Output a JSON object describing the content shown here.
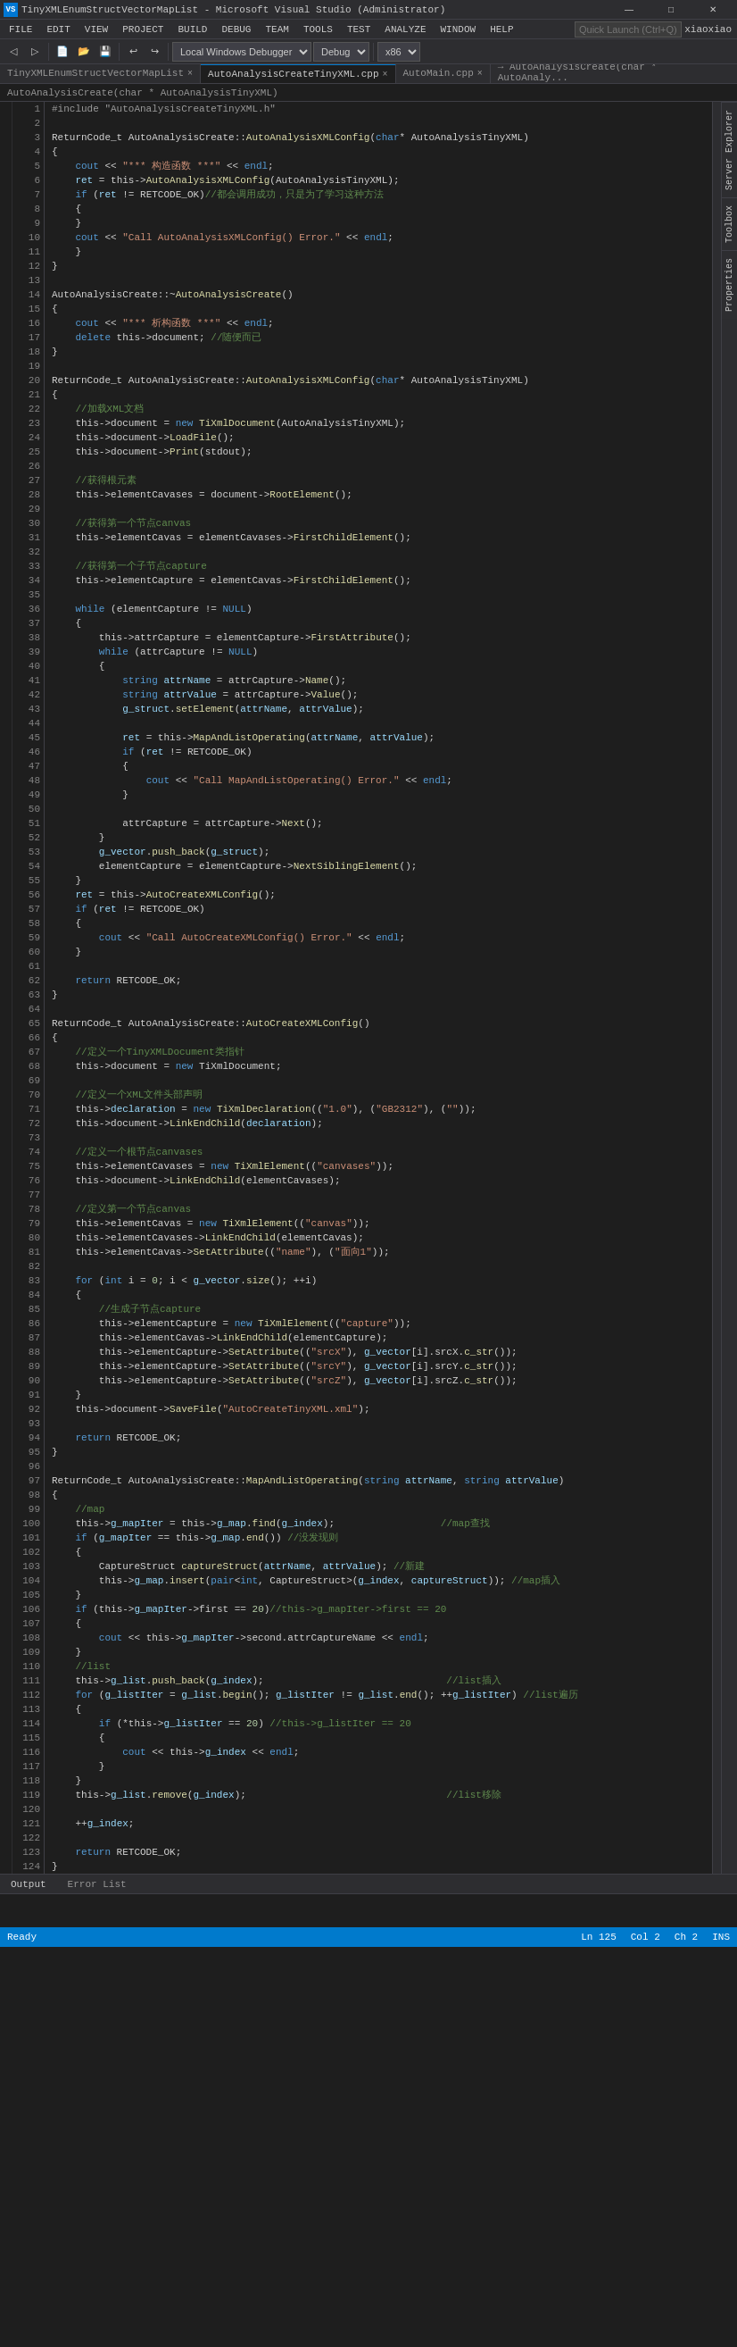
{
  "window": {
    "title": "TinyXMLEnumStructVectorMapList - Microsoft Visual Studio (Administrator)",
    "title_icon": "VS"
  },
  "titlebar": {
    "controls": [
      "—",
      "□",
      "✕"
    ]
  },
  "menubar": {
    "items": [
      "FILE",
      "EDIT",
      "VIEW",
      "PROJECT",
      "BUILD",
      "DEBUG",
      "TEAM",
      "TOOLS",
      "TEST",
      "ANALYZE",
      "WINDOW",
      "HELP"
    ]
  },
  "toolbar": {
    "config_dropdown": "Local Windows Debugger",
    "platform_dropdown": "Debug",
    "arch_dropdown": "x86",
    "username": "xiaoxiao"
  },
  "tabs": {
    "main_tabs": [
      {
        "label": "TinyXMLEnumStructVectorMapList",
        "active": false,
        "closable": true
      },
      {
        "label": "AutoAnalysisCreateTinyXML.cpp",
        "active": true,
        "closable": true
      },
      {
        "label": "AutoMain.cpp",
        "active": false,
        "closable": true
      }
    ],
    "nav_label": "→ AutoAnalysisCreate(char * AutoAnaly..."
  },
  "search": {
    "placeholder": "Quick Launch (Ctrl+Q)",
    "value": ""
  },
  "breadcrumb": "AutoAnalysisCreate(char * AutoAnalysisTinyXML)",
  "side_panels": {
    "server_explorer": "Server Explorer",
    "toolbox": "Toolbox",
    "properties": "Properties"
  },
  "code": {
    "filename": "AutoAnalysisCreateTinyXML.cpp",
    "lines": [
      {
        "num": 1,
        "text": "#include \"AutoAnalysisCreateTinyXML.h\"",
        "type": "preprocessor"
      },
      {
        "num": 2,
        "text": ""
      },
      {
        "num": 3,
        "text": "ReturnCode_t AutoAnalysisCreate::AutoAnalysisXMLConfig(char* AutoAnalysisTinyXML)",
        "type": "code"
      },
      {
        "num": 4,
        "text": "{"
      },
      {
        "num": 5,
        "text": "    cout << \"*** 构造函数 ***\" << endl;",
        "type": "code"
      },
      {
        "num": 6,
        "text": "    ret = this->AutoAnalysisXMLConfig(AutoAnalysisTinyXML);",
        "type": "code"
      },
      {
        "num": 7,
        "text": "    if (ret != RETCODE_OK)//都会调用成功，只是为了学习这种方法",
        "type": "code"
      },
      {
        "num": 8,
        "text": "    {"
      },
      {
        "num": 9,
        "text": "    }"
      },
      {
        "num": 10,
        "text": "    cout << \"Call AutoAnalysisXMLConfig() Error.\" << endl;",
        "type": "code"
      },
      {
        "num": 11,
        "text": "    }"
      },
      {
        "num": 12,
        "text": "}"
      },
      {
        "num": 13,
        "text": ""
      },
      {
        "num": 14,
        "text": "AutoAnalysisCreate::~AutoAnalysisCreate()",
        "type": "code"
      },
      {
        "num": 15,
        "text": "{"
      },
      {
        "num": 16,
        "text": "    cout << \"*** 析构函数 ***\" << endl;",
        "type": "code"
      },
      {
        "num": 17,
        "text": "    delete this->document; //随便而已",
        "type": "code"
      },
      {
        "num": 18,
        "text": "}"
      },
      {
        "num": 19,
        "text": ""
      },
      {
        "num": 20,
        "text": "ReturnCode_t AutoAnalysisCreate::AutoAnalysisXMLConfig(char* AutoAnalysisTinyXML)",
        "type": "code"
      },
      {
        "num": 21,
        "text": "{"
      },
      {
        "num": 22,
        "text": "    //加载XML文档"
      },
      {
        "num": 23,
        "text": "    this->document = new TiXmlDocument(AutoAnalysisTinyXML);"
      },
      {
        "num": 24,
        "text": "    this->document->LoadFile();"
      },
      {
        "num": 25,
        "text": "    this->document->Print(stdout);"
      },
      {
        "num": 26,
        "text": ""
      },
      {
        "num": 27,
        "text": "    //获得根元素"
      },
      {
        "num": 28,
        "text": "    this->elementCavases = document->RootElement();"
      },
      {
        "num": 29,
        "text": ""
      },
      {
        "num": 30,
        "text": "    //获得第一个节点canvas"
      },
      {
        "num": 31,
        "text": "    this->elementCavas = elementCavases->FirstChildElement();"
      },
      {
        "num": 32,
        "text": ""
      },
      {
        "num": 33,
        "text": "    //获得第一个子节点capture"
      },
      {
        "num": 34,
        "text": "    this->elementCapture = elementCavas->FirstChildElement();"
      },
      {
        "num": 35,
        "text": ""
      },
      {
        "num": 36,
        "text": "    while (elementCapture != NULL)"
      },
      {
        "num": 37,
        "text": "    {"
      },
      {
        "num": 38,
        "text": "        this->attrCapture = elementCapture->FirstAttribute();"
      },
      {
        "num": 39,
        "text": "        while (attrCapture != NULL)"
      },
      {
        "num": 40,
        "text": "        {"
      },
      {
        "num": 41,
        "text": "            string attrName = attrCapture->Name();"
      },
      {
        "num": 42,
        "text": "            string attrValue = attrCapture->Value();"
      },
      {
        "num": 43,
        "text": "            g_struct.setElement(attrName, attrValue);"
      },
      {
        "num": 44,
        "text": ""
      },
      {
        "num": 45,
        "text": "            ret = this->MapAndListOperating(attrName, attrValue);"
      },
      {
        "num": 46,
        "text": "            if (ret != RETCODE_OK)"
      },
      {
        "num": 47,
        "text": "            {"
      },
      {
        "num": 48,
        "text": "                cout << \"Call MapAndListOperating() Error.\" << endl;"
      },
      {
        "num": 49,
        "text": "            }"
      },
      {
        "num": 50,
        "text": ""
      },
      {
        "num": 51,
        "text": "            attrCapture = attrCapture->Next();"
      },
      {
        "num": 52,
        "text": "        }"
      },
      {
        "num": 53,
        "text": "        g_vector.push_back(g_struct);"
      },
      {
        "num": 54,
        "text": "        elementCapture = elementCapture->NextSiblingElement();"
      },
      {
        "num": 55,
        "text": "    }"
      },
      {
        "num": 56,
        "text": "    ret = this->AutoCreateXMLConfig();"
      },
      {
        "num": 57,
        "text": "    if (ret != RETCODE_OK)"
      },
      {
        "num": 58,
        "text": "    {"
      },
      {
        "num": 59,
        "text": "        cout << \"Call AutoCreateXMLConfig() Error.\" << endl;"
      },
      {
        "num": 60,
        "text": "    }"
      },
      {
        "num": 61,
        "text": ""
      },
      {
        "num": 62,
        "text": "    return RETCODE_OK;"
      },
      {
        "num": 63,
        "text": "}"
      },
      {
        "num": 64,
        "text": ""
      },
      {
        "num": 65,
        "text": "ReturnCode_t AutoAnalysisCreate::AutoCreateXMLConfig()",
        "type": "code"
      },
      {
        "num": 66,
        "text": "{"
      },
      {
        "num": 67,
        "text": "    //定义一个TinyXMLDocument类指针"
      },
      {
        "num": 68,
        "text": "    this->document = new TiXmlDocument;"
      },
      {
        "num": 69,
        "text": ""
      },
      {
        "num": 70,
        "text": "    //定义一个XML文件头部声明"
      },
      {
        "num": 71,
        "text": "    this->declaration = new TiXmlDeclaration((\"1.0\"), (\"GB2312\"), (\"\"));"
      },
      {
        "num": 72,
        "text": "    this->document->LinkEndChild(declaration);"
      },
      {
        "num": 73,
        "text": ""
      },
      {
        "num": 74,
        "text": "    //定义一个根节点canvases"
      },
      {
        "num": 75,
        "text": "    this->elementCavases = new TiXmlElement((\"canvases\"));"
      },
      {
        "num": 76,
        "text": "    this->document->LinkEndChild(elementCavases);"
      },
      {
        "num": 77,
        "text": ""
      },
      {
        "num": 78,
        "text": "    //定义第一个节点canvas"
      },
      {
        "num": 79,
        "text": "    this->elementCavas = new TiXmlElement((\"canvas\"));"
      },
      {
        "num": 80,
        "text": "    this->elementCavases->LinkEndChild(elementCavas);"
      },
      {
        "num": 81,
        "text": "    this->elementCavas->SetAttribute((\"name\"), (\"面向1\"));"
      },
      {
        "num": 82,
        "text": ""
      },
      {
        "num": 83,
        "text": "    for (int i = 0; i < g_vector.size(); ++i)"
      },
      {
        "num": 84,
        "text": "    {"
      },
      {
        "num": 85,
        "text": "        //生成子节点capture"
      },
      {
        "num": 86,
        "text": "        this->elementCapture = new TiXmlElement((\"capture\"));"
      },
      {
        "num": 87,
        "text": "        this->elementCavas->LinkEndChild(elementCapture);"
      },
      {
        "num": 88,
        "text": "        this->elementCapture->SetAttribute((\"srcX\"), g_vector[i].srcX.c_str());"
      },
      {
        "num": 89,
        "text": "        this->elementCapture->SetAttribute((\"srcY\"), g_vector[i].srcY.c_str());"
      },
      {
        "num": 90,
        "text": "        this->elementCapture->SetAttribute((\"srcZ\"), g_vector[i].srcZ.c_str());"
      },
      {
        "num": 91,
        "text": "    }"
      },
      {
        "num": 92,
        "text": "    this->document->SaveFile(\"AutoCreateTinyXML.xml\");"
      },
      {
        "num": 93,
        "text": ""
      },
      {
        "num": 94,
        "text": "    return RETCODE_OK;"
      },
      {
        "num": 95,
        "text": "}"
      },
      {
        "num": 96,
        "text": ""
      },
      {
        "num": 97,
        "text": "ReturnCode_t AutoAnalysisCreate::MapAndListOperating(string attrName, string attrValue)"
      },
      {
        "num": 98,
        "text": "{"
      },
      {
        "num": 99,
        "text": "    //map"
      },
      {
        "num": 100,
        "text": "    this->g_mapIter = this->g_map.find(g_index);                  //map查找"
      },
      {
        "num": 101,
        "text": "    if (g_mapIter == this->g_map.end()) //没发现则"
      },
      {
        "num": 102,
        "text": "    {"
      },
      {
        "num": 103,
        "text": "        CaptureStruct captureStruct(attrName, attrValue); //新建"
      },
      {
        "num": 104,
        "text": "        this->g_map.insert(pair<int, CaptureStruct>(g_index, captureStruct)); //map插入"
      },
      {
        "num": 105,
        "text": "    }"
      },
      {
        "num": 106,
        "text": "    if (this->g_mapIter->first == 20)//this->g_mapIter->first == 20"
      },
      {
        "num": 107,
        "text": "    {"
      },
      {
        "num": 108,
        "text": "        cout << this->g_mapIter->second.attrCaptureName << endl;"
      },
      {
        "num": 109,
        "text": "    }"
      },
      {
        "num": 110,
        "text": "    //list"
      },
      {
        "num": 111,
        "text": "    this->g_list.push_back(g_index);                               //list插入"
      },
      {
        "num": 112,
        "text": "    for (g_listIter = g_list.begin(); g_listIter != g_list.end(); ++g_listIter) //list遍历"
      },
      {
        "num": 113,
        "text": "    {"
      },
      {
        "num": 114,
        "text": "        if (*this->g_listIter == 20) //this->g_listIter == 20"
      },
      {
        "num": 115,
        "text": "        {"
      },
      {
        "num": 116,
        "text": "            cout << this->g_index << endl;"
      },
      {
        "num": 117,
        "text": "        }"
      },
      {
        "num": 118,
        "text": "    }"
      },
      {
        "num": 119,
        "text": "    this->g_list.remove(g_index);                                  //list移除"
      },
      {
        "num": 120,
        "text": ""
      },
      {
        "num": 121,
        "text": "    ++g_index;"
      },
      {
        "num": 122,
        "text": ""
      },
      {
        "num": 123,
        "text": "    return RETCODE_OK;"
      },
      {
        "num": 124,
        "text": "}"
      }
    ]
  },
  "status_bar": {
    "ready": "Ready",
    "ln": "Ln 125",
    "col": "Col 2",
    "ch": "Ch 2",
    "ins": "INS"
  },
  "bottom_panel": {
    "tabs": [
      "Output",
      "Error List"
    ]
  }
}
